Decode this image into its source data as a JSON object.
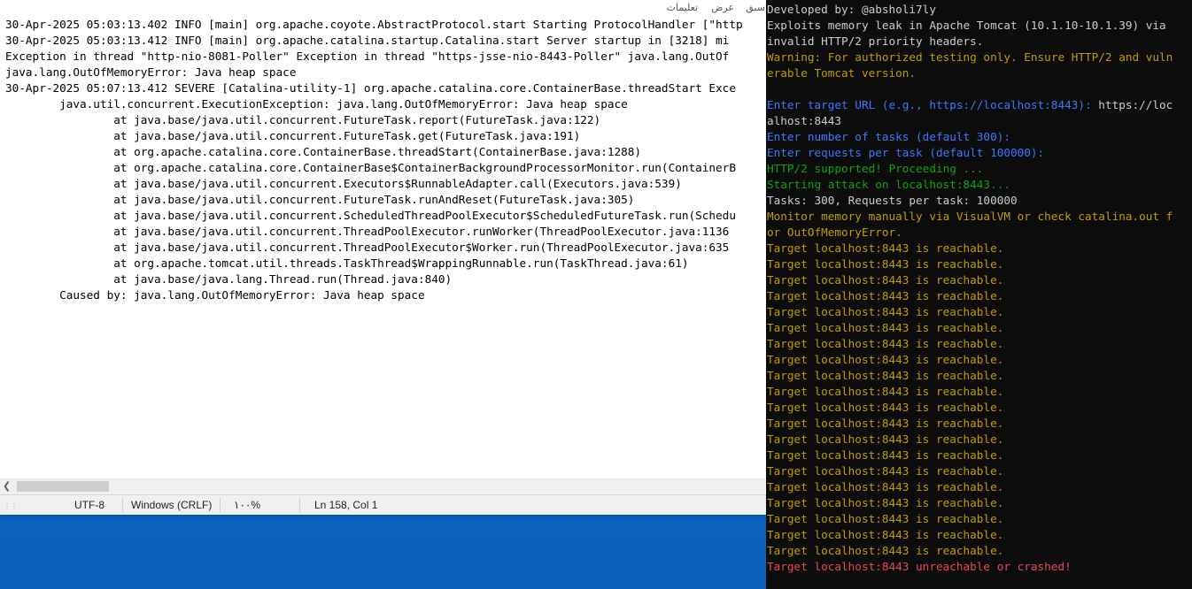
{
  "colors": {
    "desktop_blue": "#0a6fd8",
    "terminal_bg": "#0c0c0c",
    "text_white": "#cccccc",
    "text_yellow": "#c19c00",
    "text_blue": "#3b78ff",
    "text_green": "#13a10e",
    "text_red": "#e74856"
  },
  "notepad": {
    "menu": {
      "items": [
        "سبق",
        "عرض",
        "تعليمات"
      ]
    },
    "lines": [
      "30-Apr-2025 05:03:13.402 INFO [main] org.apache.coyote.AbstractProtocol.start Starting ProtocolHandler [\"http",
      "30-Apr-2025 05:03:13.412 INFO [main] org.apache.catalina.startup.Catalina.start Server startup in [3218] mi",
      "Exception in thread \"http-nio-8081-Poller\" Exception in thread \"https-jsse-nio-8443-Poller\" java.lang.OutOf",
      "java.lang.OutOfMemoryError: Java heap space",
      "30-Apr-2025 05:07:13.412 SEVERE [Catalina-utility-1] org.apache.catalina.core.ContainerBase.threadStart Exce",
      "        java.util.concurrent.ExecutionException: java.lang.OutOfMemoryError: Java heap space",
      "                at java.base/java.util.concurrent.FutureTask.report(FutureTask.java:122)",
      "                at java.base/java.util.concurrent.FutureTask.get(FutureTask.java:191)",
      "                at org.apache.catalina.core.ContainerBase.threadStart(ContainerBase.java:1288)",
      "                at org.apache.catalina.core.ContainerBase$ContainerBackgroundProcessorMonitor.run(ContainerB",
      "                at java.base/java.util.concurrent.Executors$RunnableAdapter.call(Executors.java:539)",
      "                at java.base/java.util.concurrent.FutureTask.runAndReset(FutureTask.java:305)",
      "                at java.base/java.util.concurrent.ScheduledThreadPoolExecutor$ScheduledFutureTask.run(Schedu",
      "                at java.base/java.util.concurrent.ThreadPoolExecutor.runWorker(ThreadPoolExecutor.java:1136",
      "                at java.base/java.util.concurrent.ThreadPoolExecutor$Worker.run(ThreadPoolExecutor.java:635",
      "                at org.apache.tomcat.util.threads.TaskThread$WrappingRunnable.run(TaskThread.java:61)",
      "                at java.base/java.lang.Thread.run(Thread.java:840)",
      "        Caused by: java.lang.OutOfMemoryError: Java heap space"
    ],
    "status": {
      "encoding": "UTF-8",
      "line_endings": "Windows (CRLF)",
      "zoom": "١٠٠%",
      "position": "Ln 158, Col 1"
    }
  },
  "terminal": {
    "lines": [
      {
        "text": "Developed by: @absholi7ly",
        "color": "white"
      },
      {
        "text": "Exploits memory leak in Apache Tomcat (10.1.10-10.1.39) via",
        "color": "white"
      },
      {
        "text": "invalid HTTP/2 priority headers.",
        "color": "white"
      },
      {
        "text": "Warning: For authorized testing only. Ensure HTTP/2 and vuln",
        "color": "yellow"
      },
      {
        "text": "erable Tomcat version.",
        "color": "yellow"
      },
      {
        "text": "",
        "color": "white"
      },
      {
        "text": "Enter target URL (e.g., https://localhost:8443): ",
        "color": "blue",
        "suffix": "https://loc"
      },
      {
        "text": "alhost:8443",
        "color": "white"
      },
      {
        "text": "Enter number of tasks (default 300):",
        "color": "blue"
      },
      {
        "text": "Enter requests per task (default 100000):",
        "color": "blue"
      },
      {
        "text": "HTTP/2 supported! Proceeding ...",
        "color": "green"
      },
      {
        "text": "Starting attack on localhost:8443...",
        "color": "green"
      },
      {
        "text": "Tasks: 300, Requests per task: 100000",
        "color": "white"
      },
      {
        "text": "Monitor memory manually via VisualVM or check catalina.out f",
        "color": "yellow"
      },
      {
        "text": "or OutOfMemoryError.",
        "color": "yellow"
      },
      {
        "text": "Target localhost:8443 is reachable.",
        "color": "yellow"
      },
      {
        "text": "Target localhost:8443 is reachable.",
        "color": "yellow"
      },
      {
        "text": "Target localhost:8443 is reachable.",
        "color": "yellow"
      },
      {
        "text": "Target localhost:8443 is reachable.",
        "color": "yellow"
      },
      {
        "text": "Target localhost:8443 is reachable.",
        "color": "yellow"
      },
      {
        "text": "Target localhost:8443 is reachable.",
        "color": "yellow"
      },
      {
        "text": "Target localhost:8443 is reachable.",
        "color": "yellow"
      },
      {
        "text": "Target localhost:8443 is reachable.",
        "color": "yellow"
      },
      {
        "text": "Target localhost:8443 is reachable.",
        "color": "yellow"
      },
      {
        "text": "Target localhost:8443 is reachable.",
        "color": "yellow"
      },
      {
        "text": "Target localhost:8443 is reachable.",
        "color": "yellow"
      },
      {
        "text": "Target localhost:8443 is reachable.",
        "color": "yellow"
      },
      {
        "text": "Target localhost:8443 is reachable.",
        "color": "yellow"
      },
      {
        "text": "Target localhost:8443 is reachable.",
        "color": "yellow"
      },
      {
        "text": "Target localhost:8443 is reachable.",
        "color": "yellow"
      },
      {
        "text": "Target localhost:8443 is reachable.",
        "color": "yellow"
      },
      {
        "text": "Target localhost:8443 is reachable.",
        "color": "yellow"
      },
      {
        "text": "Target localhost:8443 is reachable.",
        "color": "yellow"
      },
      {
        "text": "Target localhost:8443 is reachable.",
        "color": "yellow"
      },
      {
        "text": "Target localhost:8443 is reachable.",
        "color": "yellow"
      },
      {
        "text": "Target localhost:8443 unreachable or crashed!",
        "color": "red"
      }
    ]
  }
}
